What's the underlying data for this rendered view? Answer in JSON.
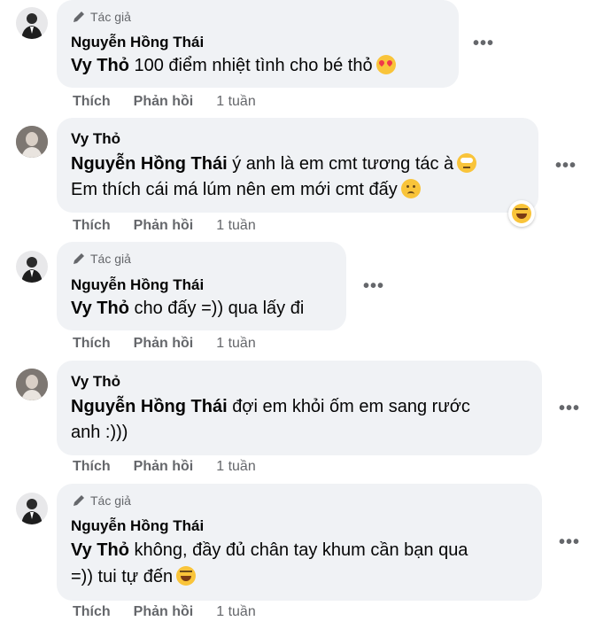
{
  "comments": [
    {
      "author": "Nguyễn Hồng Thái",
      "is_author_badge": true,
      "badge_label": "Tác giả",
      "mention": "Vy Thỏ",
      "text": "100 điểm nhiệt tình cho bé thỏ",
      "emoji": "smiling-face-with-hearts",
      "actions": {
        "like": "Thích",
        "reply": "Phản hồi",
        "time": "1 tuần"
      }
    },
    {
      "author": "Vy Thỏ",
      "mention": "Nguyễn Hồng Thái",
      "text": "ý anh là em cmt tương tác à",
      "text_line2": "Em thích cái má lúm nên em mới cmt đấy",
      "emoji": "face-with-rolling-eyes",
      "emoji2": "confused-face",
      "reaction": "laughing-face",
      "actions": {
        "like": "Thích",
        "reply": "Phản hồi",
        "time": "1 tuần"
      }
    },
    {
      "author": "Nguyễn Hồng Thái",
      "is_author_badge": true,
      "badge_label": "Tác giả",
      "mention": "Vy Thỏ",
      "text": "cho đấy =)) qua lấy đi",
      "actions": {
        "like": "Thích",
        "reply": "Phản hồi",
        "time": "1 tuần"
      }
    },
    {
      "author": "Vy Thỏ",
      "mention": "Nguyễn Hồng Thái",
      "text": "đợi em khỏi ốm em sang rước",
      "text_line2": "anh :)))",
      "actions": {
        "like": "Thích",
        "reply": "Phản hồi",
        "time": "1 tuần"
      }
    },
    {
      "author": "Nguyễn Hồng Thái",
      "is_author_badge": true,
      "badge_label": "Tác giả",
      "mention": "Vy Thỏ",
      "text": "không, đầy đủ chân tay khum cần bạn qua",
      "text_line2": "=)) tui tự đến",
      "emoji": "grinning-squinting-face",
      "actions": {
        "like": "Thích",
        "reply": "Phản hồi",
        "time": "1 tuần"
      }
    }
  ],
  "more_icon": "more-options-icon",
  "colors": {
    "bubble": "#f0f2f5",
    "muted": "#65676b",
    "text": "#050505"
  }
}
